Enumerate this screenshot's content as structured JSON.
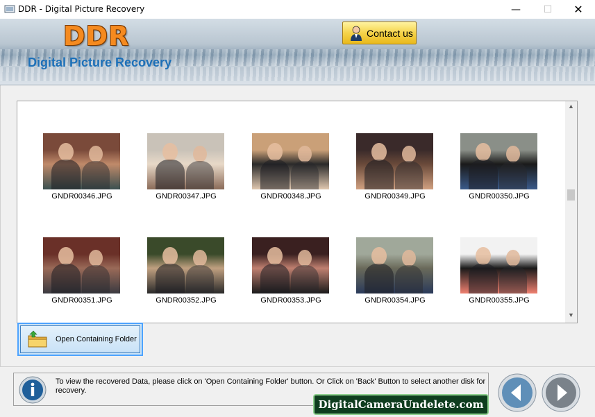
{
  "window": {
    "title": "DDR - Digital Picture Recovery",
    "minimize_glyph": "—",
    "maximize_glyph": "☐",
    "close_glyph": "✕"
  },
  "banner": {
    "logo": "DDR",
    "subtitle": "Digital Picture Recovery",
    "contact_label": "Contact us"
  },
  "gallery": {
    "items": [
      {
        "name": "GNDR00346.JPG",
        "colors": [
          "#7a4a3a",
          "#c08a6a",
          "#3a5050"
        ]
      },
      {
        "name": "GNDR00347.JPG",
        "colors": [
          "#c9c2b8",
          "#e8d9c8",
          "#8a6a58"
        ]
      },
      {
        "name": "GNDR00348.JPG",
        "colors": [
          "#caa078",
          "#2a2a2a",
          "#e0c8b0"
        ]
      },
      {
        "name": "GNDR00349.JPG",
        "colors": [
          "#3a2a2a",
          "#6a4a3a",
          "#d0a080"
        ]
      },
      {
        "name": "GNDR00350.JPG",
        "colors": [
          "#8a8f88",
          "#1a1a1a",
          "#3a5a8a"
        ]
      },
      {
        "name": "GNDR00351.JPG",
        "colors": [
          "#6a3028",
          "#9a6a58",
          "#3a3a40"
        ]
      },
      {
        "name": "GNDR00352.JPG",
        "colors": [
          "#3a4a2a",
          "#c0a080",
          "#2a2a2a"
        ]
      },
      {
        "name": "GNDR00353.JPG",
        "colors": [
          "#3a2020",
          "#c08070",
          "#1a1a1a"
        ]
      },
      {
        "name": "GNDR00354.JPG",
        "colors": [
          "#a0a89a",
          "#6a6a5a",
          "#2a3a5a"
        ]
      },
      {
        "name": "GNDR00355.JPG",
        "colors": [
          "#f2f2f2",
          "#1a1a1a",
          "#f08070"
        ]
      }
    ]
  },
  "actions": {
    "open_folder_label": "Open Containing Folder"
  },
  "status": {
    "info_text": "To view the recovered Data, please click on 'Open Containing Folder' button. Or Click on 'Back' Button to select another disk for recovery."
  },
  "watermark": "DigitalCameraUndelete.com",
  "colors": {
    "accent": "#1d70b8",
    "logo": "#f58a1f",
    "contact_button": "#f5d34a",
    "watermark_bg": "#0f3d1f"
  }
}
